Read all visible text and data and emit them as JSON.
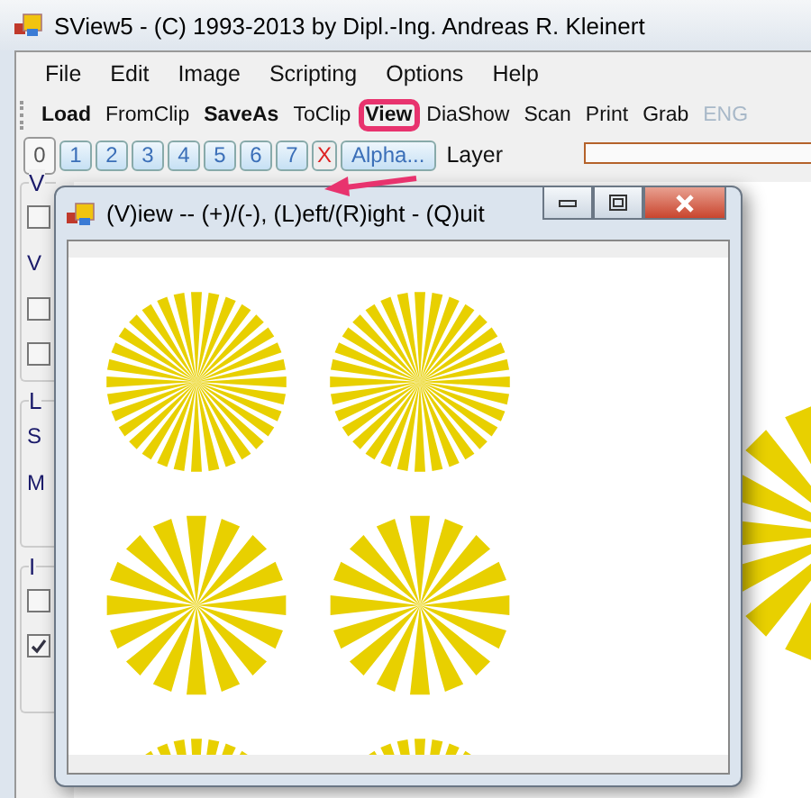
{
  "window": {
    "title": "SView5 - (C) 1993-2013 by Dipl.-Ing. Andreas R. Kleinert"
  },
  "menu": [
    "File",
    "Edit",
    "Image",
    "Scripting",
    "Options",
    "Help"
  ],
  "toolbar": [
    {
      "label": "Load",
      "bold": true,
      "disabled": false,
      "highlighted": false
    },
    {
      "label": "FromClip",
      "bold": false,
      "disabled": false,
      "highlighted": false
    },
    {
      "label": "SaveAs",
      "bold": true,
      "disabled": false,
      "highlighted": false
    },
    {
      "label": "ToClip",
      "bold": false,
      "disabled": false,
      "highlighted": false
    },
    {
      "label": "View",
      "bold": true,
      "disabled": false,
      "highlighted": true
    },
    {
      "label": "DiaShow",
      "bold": false,
      "disabled": false,
      "highlighted": false
    },
    {
      "label": "Scan",
      "bold": false,
      "disabled": false,
      "highlighted": false
    },
    {
      "label": "Print",
      "bold": false,
      "disabled": false,
      "highlighted": false
    },
    {
      "label": "Grab",
      "bold": false,
      "disabled": false,
      "highlighted": false
    },
    {
      "label": "ENG",
      "bold": false,
      "disabled": true,
      "highlighted": false
    }
  ],
  "layers": {
    "buttons": [
      {
        "label": "0",
        "kind": "number",
        "selected": true
      },
      {
        "label": "1",
        "kind": "number",
        "selected": false
      },
      {
        "label": "2",
        "kind": "number",
        "selected": false
      },
      {
        "label": "3",
        "kind": "number",
        "selected": false
      },
      {
        "label": "4",
        "kind": "number",
        "selected": false
      },
      {
        "label": "5",
        "kind": "number",
        "selected": false
      },
      {
        "label": "6",
        "kind": "number",
        "selected": false
      },
      {
        "label": "7",
        "kind": "number",
        "selected": false
      },
      {
        "label": "X",
        "kind": "clear",
        "selected": false
      },
      {
        "label": "Alpha...",
        "kind": "alpha",
        "selected": false
      }
    ],
    "label": "Layer"
  },
  "side_panel": {
    "groups": [
      {
        "title": "V",
        "items": [
          {
            "kind": "checkbox",
            "checked": false
          },
          {
            "kind": "label",
            "text": "V"
          },
          {
            "kind": "checkbox",
            "checked": false
          },
          {
            "kind": "checkbox",
            "checked": false
          }
        ]
      },
      {
        "title": "L",
        "items": [
          {
            "kind": "label",
            "text": "S"
          },
          {
            "kind": "label",
            "text": "M"
          }
        ]
      },
      {
        "title": "I",
        "items": [
          {
            "kind": "checkbox",
            "checked": false
          },
          {
            "kind": "checkbox",
            "checked": true
          }
        ]
      }
    ]
  },
  "view_window": {
    "title": "(V)iew -- (+)/(-), (L)eft/(R)ight - (Q)uit",
    "thumbnails": [
      {
        "kind": "thin-rays"
      },
      {
        "kind": "thin-rays"
      },
      {
        "kind": "wide-rays"
      },
      {
        "kind": "wide-rays"
      },
      {
        "kind": "thin-rays"
      },
      {
        "kind": "thin-rays"
      }
    ]
  }
}
